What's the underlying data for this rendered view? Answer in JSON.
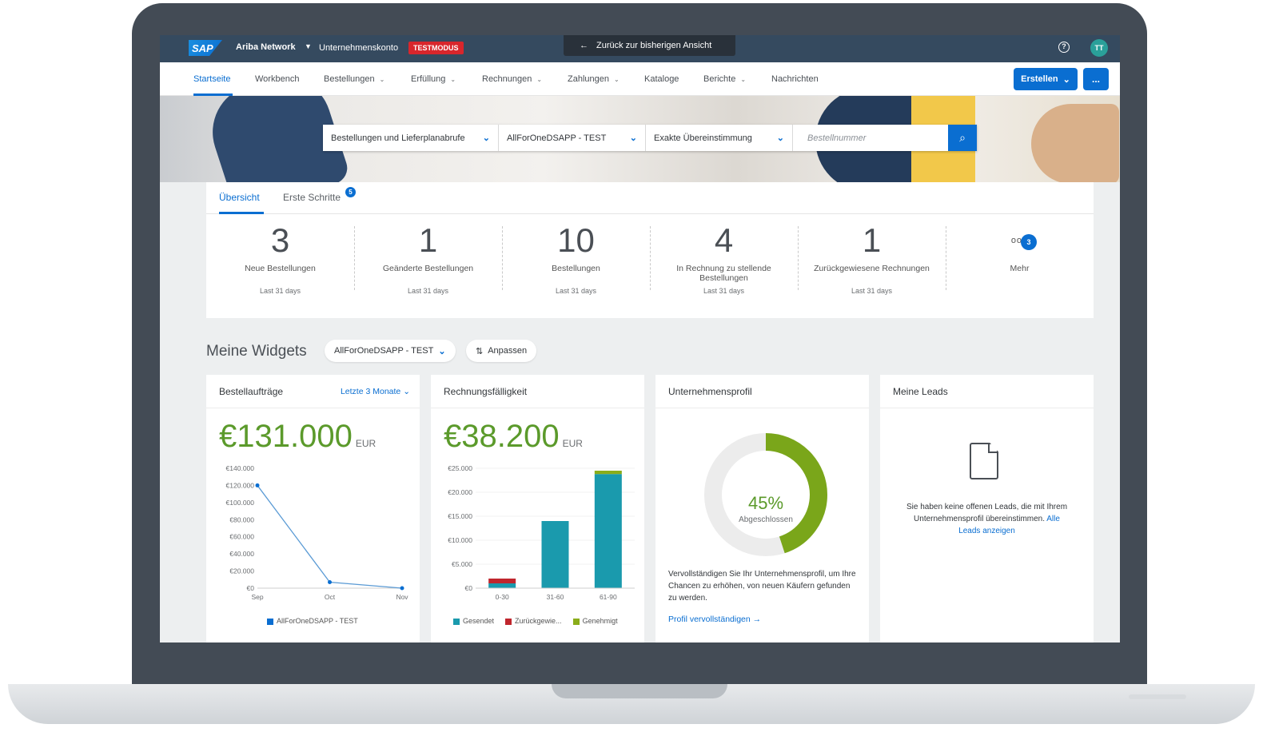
{
  "shell": {
    "logo": "SAP",
    "product": "Ariba Network",
    "account": "Unternehmenskonto",
    "mode_badge": "TESTMODUS",
    "back_label": "Zurück zur bisherigen Ansicht",
    "avatar_initials": "TT"
  },
  "nav": {
    "items": [
      "Startseite",
      "Workbench",
      "Bestellungen",
      "Erfüllung",
      "Rechnungen",
      "Zahlungen",
      "Kataloge",
      "Berichte",
      "Nachrichten"
    ],
    "create_label": "Erstellen",
    "more_label": "..."
  },
  "search": {
    "doc_type": "Bestellungen und Lieferplanabrufe",
    "customer": "AllForOneDSAPP - TEST",
    "match": "Exakte Übereinstimmung",
    "placeholder": "Bestellnummer"
  },
  "overview": {
    "tabs": [
      "Übersicht",
      "Erste Schritte"
    ],
    "tab_badge": "5",
    "kpis": [
      {
        "value": "3",
        "label": "Neue Bestellungen",
        "sub": "Last 31 days"
      },
      {
        "value": "1",
        "label": "Geänderte Bestellungen",
        "sub": "Last 31 days"
      },
      {
        "value": "10",
        "label": "Bestellungen",
        "sub": "Last 31 days"
      },
      {
        "value": "4",
        "label": "In Rechnung zu stellende Bestellungen",
        "sub": "Last 31 days"
      },
      {
        "value": "1",
        "label": "Zurückgewiesene Rechnungen",
        "sub": "Last 31 days"
      }
    ],
    "more_label": "Mehr",
    "more_badge": "3"
  },
  "widgets": {
    "title": "Meine Widgets",
    "customer_filter": "AllForOneDSAPP - TEST",
    "customize_label": "Anpassen"
  },
  "orders_card": {
    "title": "Bestellaufträge",
    "period": "Letzte 3 Monate",
    "amount": "€131.000",
    "currency": "EUR"
  },
  "invoice_card": {
    "title": "Rechnungsfälligkeit",
    "amount": "€38.200",
    "currency": "EUR"
  },
  "profile_card": {
    "title": "Unternehmensprofil",
    "percent": "45%",
    "percent_label": "Abgeschlossen",
    "text": "Vervollständigen Sie Ihr Unternehmensprofil, um Ihre Chancen zu erhöhen, von neuen Käufern gefunden zu werden.",
    "link": "Profil vervollständigen"
  },
  "leads_card": {
    "title": "Meine Leads",
    "text": "Sie haben keine offenen Leads, die mit Ihrem Unternehmensprofil übereinstimmen.",
    "link": "Alle Leads anzeigen"
  },
  "colors": {
    "accent": "#0a6ed1",
    "shell": "#354a5f",
    "amount_green": "#5b9a2b",
    "bar_teal": "#1a9aad",
    "bar_red": "#c0262d",
    "bar_olive": "#8aad1a"
  },
  "chart_data": [
    {
      "type": "line",
      "x": [
        "Sep",
        "Oct",
        "Nov"
      ],
      "y_ticks": [
        "€140.000",
        "€120.000",
        "€100.000",
        "€80.000",
        "€60.000",
        "€40.000",
        "€20.000",
        "€0"
      ],
      "series": [
        {
          "name": "AllForOneDSAPP - TEST",
          "values": [
            120000,
            7000,
            0
          ]
        }
      ],
      "ylim": [
        0,
        140000
      ]
    },
    {
      "type": "bar",
      "stacked": true,
      "categories": [
        "0-30",
        "31-60",
        "61-90"
      ],
      "y_ticks": [
        "€25.000",
        "€20.000",
        "€15.000",
        "€10.000",
        "€5.000",
        "€0"
      ],
      "series": [
        {
          "name": "Gesendet",
          "values": [
            1000,
            14000,
            23800
          ]
        },
        {
          "name": "Zurückgewie...",
          "values": [
            1000,
            0,
            0
          ]
        },
        {
          "name": "Genehmigt",
          "values": [
            0,
            0,
            700
          ]
        }
      ],
      "ylim": [
        0,
        25000
      ]
    }
  ]
}
